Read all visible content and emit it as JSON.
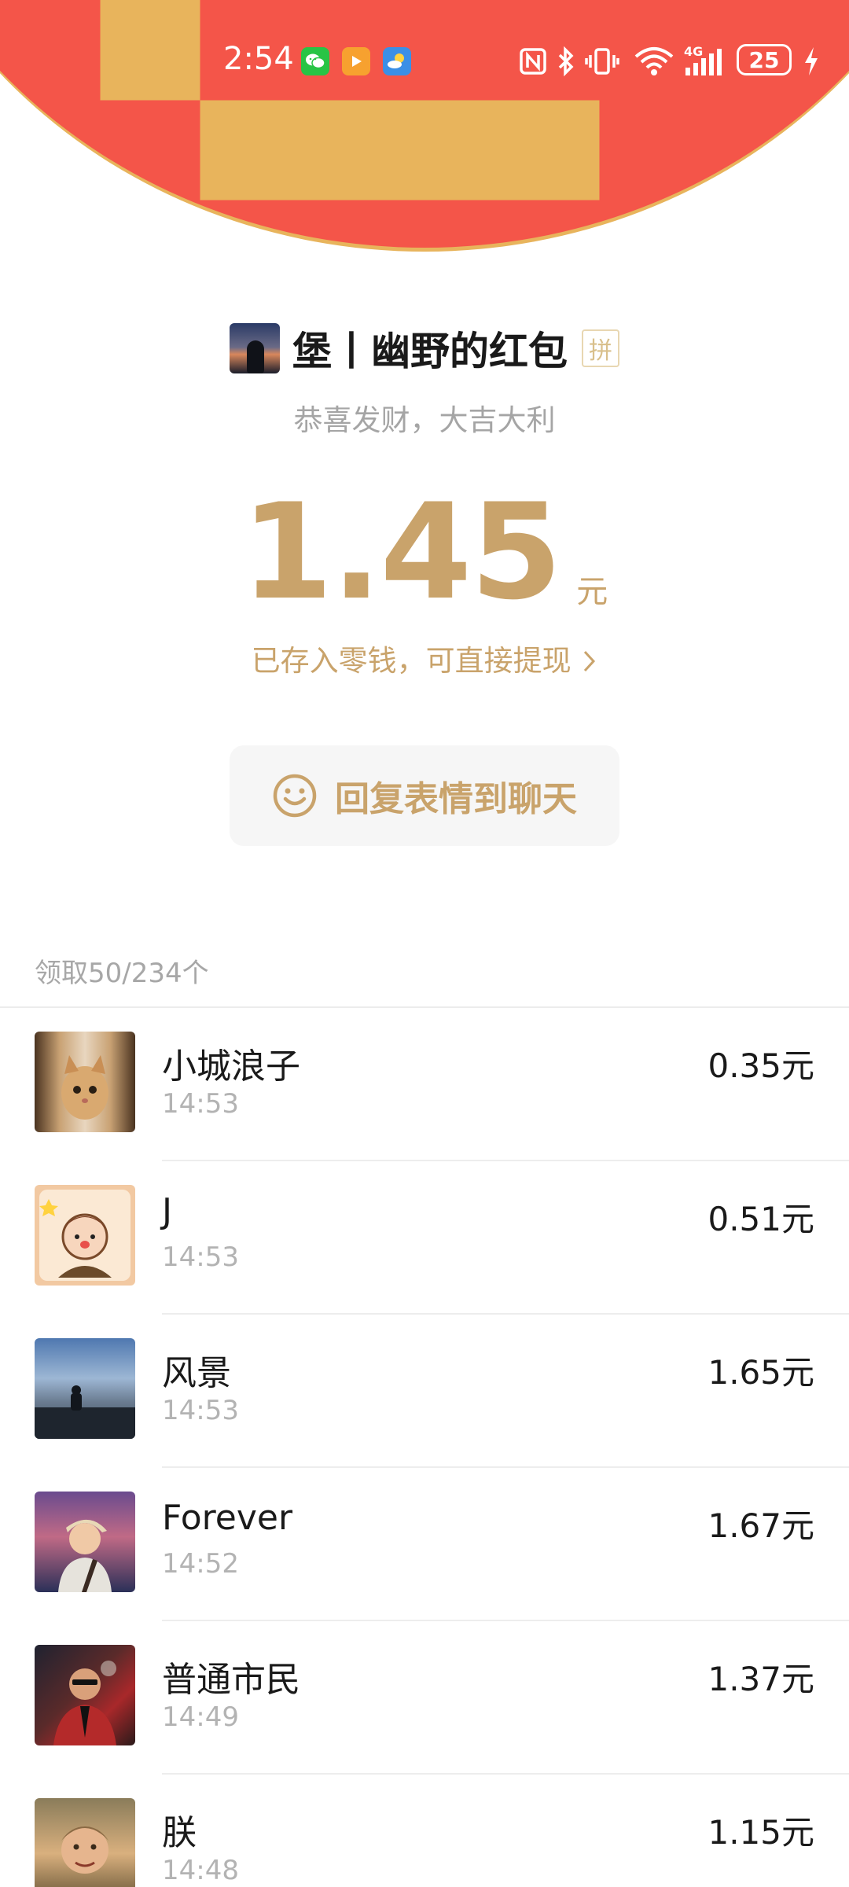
{
  "status_bar": {
    "time": "2:54",
    "battery": "25",
    "network": "4G",
    "app_icons": [
      "wechat-icon",
      "video-play-icon",
      "weather-icon"
    ],
    "system_icons": [
      "nfc-icon",
      "bluetooth-icon",
      "vibrate-icon",
      "wifi-icon",
      "signal-icon",
      "charging-icon"
    ]
  },
  "nav": {
    "back_icon": "chevron-left-icon",
    "more_icon": "more-dots-icon"
  },
  "envelope": {
    "sender_title": "堡丨幽野的红包",
    "badge": "拼",
    "greeting": "恭喜发财，大吉大利",
    "amount": "1.45",
    "unit": "元",
    "saved_text": "已存入零钱，可直接提现",
    "reply_button": "回复表情到聊天"
  },
  "summary": {
    "claimed_text": "领取50/234个"
  },
  "recipients": [
    {
      "name": "小城浪子",
      "time": "14:53",
      "amount": "0.35元"
    },
    {
      "name": "J",
      "time": "14:53",
      "amount": "0.51元"
    },
    {
      "name": "风景",
      "time": "14:53",
      "amount": "1.65元"
    },
    {
      "name": "Forever",
      "time": "14:52",
      "amount": "1.67元"
    },
    {
      "name": "普通市民",
      "time": "14:49",
      "amount": "1.37元"
    },
    {
      "name": "朕",
      "time": "14:48",
      "amount": "1.15元"
    }
  ],
  "colors": {
    "header_red": "#f45549",
    "gold": "#c9a36b",
    "border_gold": "#e8b45c"
  }
}
